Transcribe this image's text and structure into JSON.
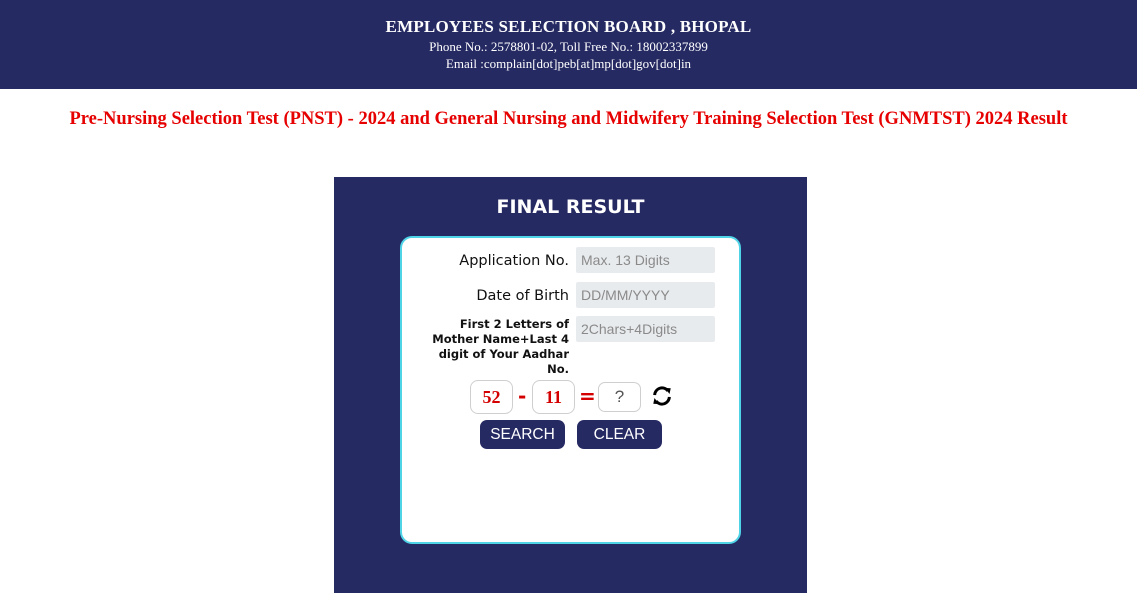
{
  "header": {
    "org": "EMPLOYEES SELECTION BOARD , BHOPAL",
    "phone": "Phone No.: 2578801-02, Toll Free No.: 18002337899",
    "email": "Email :complain[dot]peb[at]mp[dot]gov[dot]in"
  },
  "page_title": "Pre-Nursing Selection Test (PNST) - 2024 and General Nursing and Midwifery Training Selection Test (GNMTST) 2024 Result",
  "panel": {
    "title": "FINAL RESULT",
    "fields": {
      "application_label": "Application No.",
      "application_placeholder": "Max. 13 Digits",
      "dob_label": "Date of Birth",
      "dob_placeholder": "DD/MM/YYYY",
      "mother_label": "First 2 Letters of Mother Name+Last 4 digit of Your Aadhar No.",
      "mother_placeholder": "2Chars+4Digits"
    },
    "captcha": {
      "num1": "52",
      "operator": "-",
      "num2": "11",
      "equals": "=",
      "answer_placeholder": "?"
    },
    "buttons": {
      "search": "SEARCH",
      "clear": "CLEAR"
    }
  },
  "icons": {
    "refresh": "refresh-icon"
  },
  "colors": {
    "navy": "#262a63",
    "title_red": "#e60000",
    "card_border": "#4fd3e6"
  }
}
